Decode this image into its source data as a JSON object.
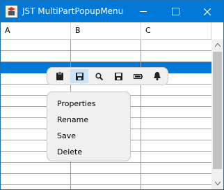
{
  "window": {
    "title": "JST MultiPartPopupMenu"
  },
  "table": {
    "columns": [
      "A",
      "B",
      "C"
    ],
    "row_count": 14,
    "selected_row": 2
  },
  "popup": {
    "toolbar_icons": [
      "clipboard-icon",
      "save-disk-icon",
      "search-icon",
      "save-disk-icon",
      "battery-icon",
      "bell-icon"
    ],
    "active_icon_index": 1,
    "menu_items": [
      "Properties",
      "Rename",
      "Save",
      "Delete"
    ]
  },
  "colors": {
    "accent": "#0078d7",
    "selection": "#0078d7",
    "popup_bg": "#f0f0f0"
  }
}
